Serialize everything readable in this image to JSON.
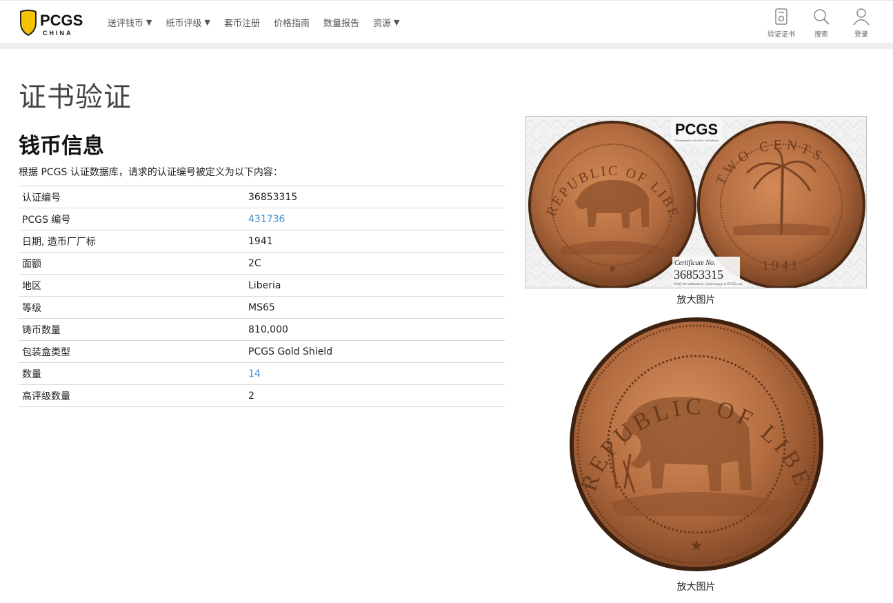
{
  "header": {
    "logo_text": "PCGS",
    "logo_sub": "CHINA",
    "nav": [
      {
        "label": "送评钱币",
        "dropdown": true
      },
      {
        "label": "纸币评级",
        "dropdown": true
      },
      {
        "label": "套币注册",
        "dropdown": false
      },
      {
        "label": "价格指南",
        "dropdown": false
      },
      {
        "label": "数量报告",
        "dropdown": false
      },
      {
        "label": "资源",
        "dropdown": true
      }
    ],
    "caret": "▼",
    "tools": [
      {
        "label": "验证证书",
        "icon": "certificate-icon"
      },
      {
        "label": "搜索",
        "icon": "search-icon"
      },
      {
        "label": "登录",
        "icon": "user-icon"
      }
    ]
  },
  "page": {
    "title": "证书验证",
    "section_title": "钱币信息",
    "intro": "根据 PCGS 认证数据库，请求的认证编号被定义为以下内容："
  },
  "info_rows": [
    {
      "key": "认证编号",
      "value": "36853315",
      "link": false
    },
    {
      "key": "PCGS 编号",
      "value": "431736",
      "link": true
    },
    {
      "key": "日期, 造币厂厂标",
      "value": "1941",
      "link": false
    },
    {
      "key": "面额",
      "value": "2C",
      "link": false
    },
    {
      "key": "地区",
      "value": "Liberia",
      "link": false
    },
    {
      "key": "等级",
      "value": "MS65",
      "link": false
    },
    {
      "key": "铸币数量",
      "value": "810,000",
      "link": false
    },
    {
      "key": "包装盒类型",
      "value": "PCGS Gold Shield",
      "link": false
    },
    {
      "key": "数量",
      "value": "14",
      "link": true
    },
    {
      "key": "高评级数量",
      "value": "2",
      "link": false
    }
  ],
  "images": {
    "enlarge_label_1": "放大图片",
    "enlarge_label_2": "放大图片",
    "slab_logo": "PCGS",
    "slab_tagline": "The Standard for the Rare Coin Industry",
    "cert_label": "Certificate No.",
    "cert_number": "36853315",
    "verify_text": "Verify the authenticity of this image at PCGS.com",
    "obverse_legend": "REPUBLIC OF LIBERIA",
    "reverse_legend": "TWO CENTS",
    "reverse_year": "1941"
  },
  "colors": {
    "link": "#3d8fd6",
    "shield_yellow": "#f5c400",
    "copper": "#b06a3e"
  }
}
